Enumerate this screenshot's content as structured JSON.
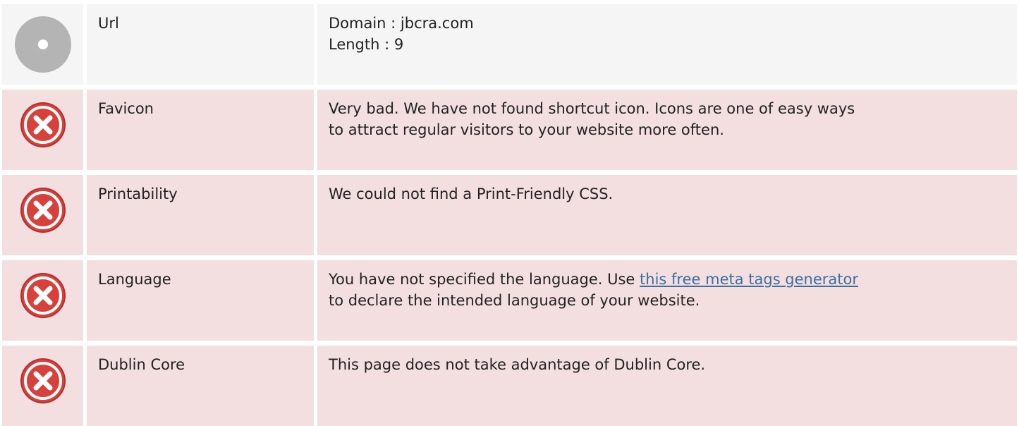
{
  "rows": [
    {
      "status": "neutral",
      "icon": "neutral-dot-icon",
      "label": "Url",
      "lines": [
        "Domain : jbcra.com",
        "Length : 9"
      ]
    },
    {
      "status": "bad",
      "icon": "error-x-icon",
      "label": "Favicon",
      "lines": [
        "Very bad. We have not found shortcut icon. Icons are one of easy ways",
        "to attract regular visitors to your website more often."
      ]
    },
    {
      "status": "bad",
      "icon": "error-x-icon",
      "label": "Printability",
      "lines": [
        "We could not find a Print-Friendly CSS."
      ]
    },
    {
      "status": "bad",
      "icon": "error-x-icon",
      "label": "Language",
      "text_before_link": "You have not specified the language. Use ",
      "link_text": "this free meta tags generator",
      "text_after_link": "to declare the intended language of your website."
    },
    {
      "status": "bad",
      "icon": "error-x-icon",
      "label": "Dublin Core",
      "lines": [
        "This page does not take advantage of Dublin Core."
      ]
    }
  ],
  "colors": {
    "neutral_bg": "#f5f5f5",
    "bad_bg": "#f3dfe0",
    "error_red": "#d8403c",
    "neutral_grey": "#b4b4b4",
    "link": "#3b6fa0"
  }
}
